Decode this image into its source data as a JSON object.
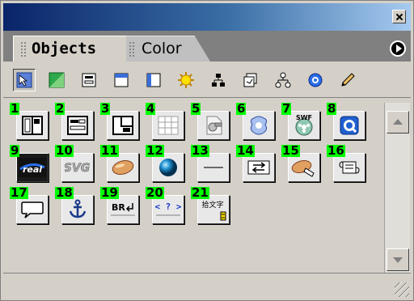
{
  "tabs": [
    {
      "label": "Objects"
    },
    {
      "label": "Color"
    }
  ],
  "categories": [
    {
      "icon": "common-objects-icon",
      "selected": true
    },
    {
      "icon": "image-icon"
    },
    {
      "icon": "form-icon"
    },
    {
      "icon": "frames-icon"
    },
    {
      "icon": "layout-icon"
    },
    {
      "icon": "special-sun-icon"
    },
    {
      "icon": "site-map-icon"
    },
    {
      "icon": "templates-icon"
    },
    {
      "icon": "hierarchy-icon"
    },
    {
      "icon": "quicktime-icon"
    },
    {
      "icon": "pencil-icon"
    }
  ],
  "objects": [
    {
      "num": "1",
      "icon": "layout-table-icon"
    },
    {
      "num": "2",
      "icon": "form-object-icon"
    },
    {
      "num": "3",
      "icon": "layer-frame-icon"
    },
    {
      "num": "4",
      "icon": "table-grid-icon"
    },
    {
      "num": "5",
      "icon": "plugin-icon"
    },
    {
      "num": "6",
      "icon": "java-applet-icon"
    },
    {
      "num": "7",
      "icon": "swf-film-icon",
      "text": "SWF"
    },
    {
      "num": "8",
      "icon": "quicktime-icon"
    },
    {
      "num": "9",
      "icon": "real-media-icon",
      "text": "real"
    },
    {
      "num": "10",
      "icon": "svg-icon",
      "text": "SVG"
    },
    {
      "num": "11",
      "icon": "activex-pill-icon"
    },
    {
      "num": "12",
      "icon": "shockwave-sphere-icon"
    },
    {
      "num": "13",
      "icon": "horizontal-rule-icon"
    },
    {
      "num": "14",
      "icon": "marquee-icon"
    },
    {
      "num": "15",
      "icon": "script-scroll-icon"
    },
    {
      "num": "16",
      "icon": "scroll-icon"
    },
    {
      "num": "17",
      "icon": "comment-bubble-icon"
    },
    {
      "num": "18",
      "icon": "anchor-icon"
    },
    {
      "num": "19",
      "icon": "line-break-icon",
      "text": "BR"
    },
    {
      "num": "20",
      "icon": "unknown-tag-icon",
      "text": "< ? >"
    },
    {
      "num": "21",
      "icon": "ruby-text-icon",
      "text": "拾文字"
    }
  ]
}
